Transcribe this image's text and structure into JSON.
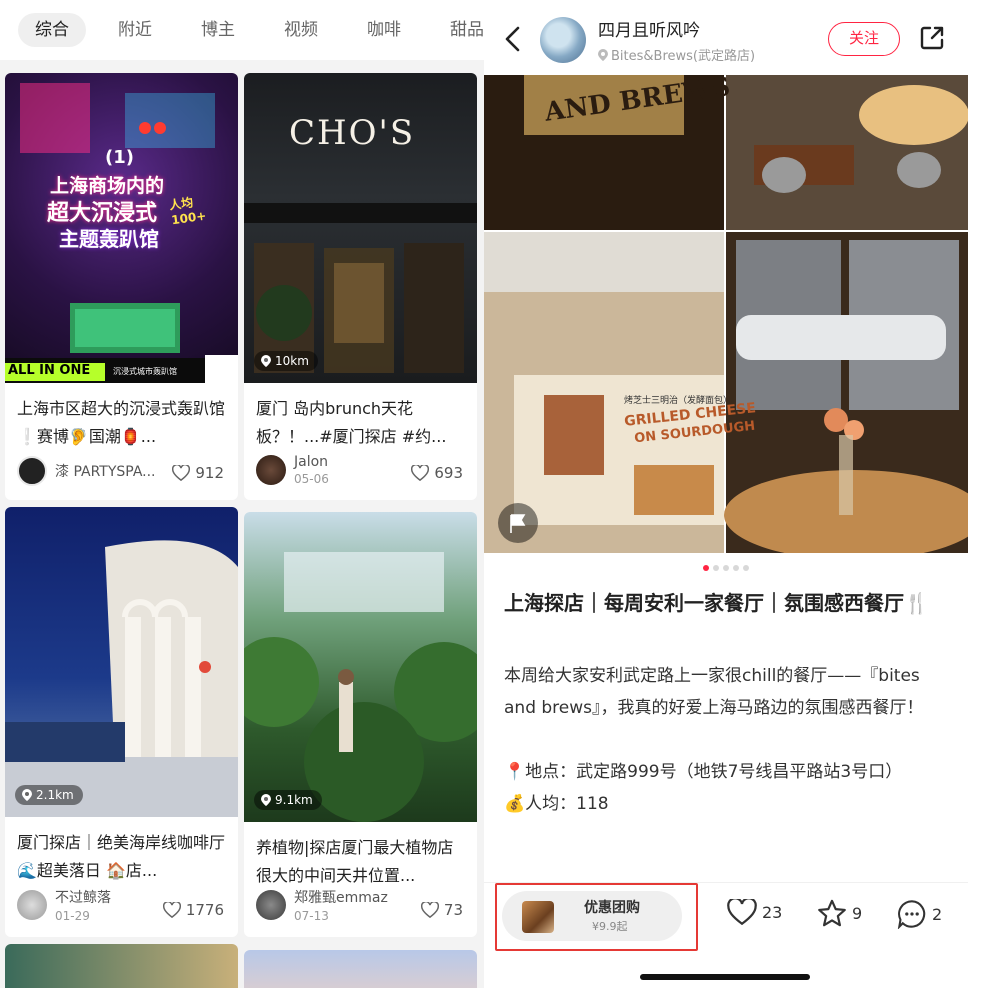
{
  "feed": {
    "tabs": [
      "综合",
      "附近",
      "博主",
      "视频",
      "咖啡",
      "甜品"
    ],
    "active_tab": "综合",
    "cards": [
      {
        "cover_text": {
          "top": "(1)",
          "l1": "上海商场内的",
          "l2": "超大沉浸式",
          "l3": "主题轰趴馆",
          "price": "人均100+",
          "footer": "ALL IN ONE",
          "footer_sub": "沉浸式城市轰趴馆"
        },
        "title": "上海市区超大的沉浸式轰趴馆❕赛博🦻国潮🏮...",
        "author": "漆 PARTYSPA...",
        "date": "",
        "likes": "912",
        "distance": ""
      },
      {
        "cover_text": {
          "sign": "CHO'S"
        },
        "title": "厦门 岛内brunch天花板？！...#厦门探店 #约...",
        "author": "Jalon",
        "date": "05-06",
        "likes": "693",
        "distance": "10km"
      },
      {
        "title": "厦门探店｜绝美海岸线咖啡厅🌊超美落日 🏠店...",
        "author": "不过鲸落",
        "date": "01-29",
        "likes": "1776",
        "distance": "2.1km"
      },
      {
        "title": "养植物|探店厦门最大植物店 很大的中间天井位置...",
        "author": "郑雅甄emmaz",
        "date": "07-13",
        "likes": "73",
        "distance": "9.1km"
      }
    ]
  },
  "post": {
    "author": "四月且听风吟",
    "location": "Bites&Brews(武定路店)",
    "follow_label": "关注",
    "photo_text": {
      "sign": "AND BREWS",
      "menu_l1": "GRILLED CHEESE",
      "menu_l2": "ON SOURDOUGH",
      "menu_cn": "烤芝士三明治（发酵面包）"
    },
    "page_count": 5,
    "current_page": 1,
    "title": "上海探店｜每周安利一家餐厅｜氛围感西餐厅🍴",
    "body_p1": "本周给大家安利武定路上一家很chill的餐厅——『bites and brews』，我真的好爱上海马路边的氛围感西餐厅！",
    "body_p2": "📍地点：武定路999号（地铁7号线昌平路站3号口）",
    "body_p3": "💰人均：118",
    "deal": {
      "title": "优惠团购",
      "price": "¥9.9起"
    },
    "likes": "23",
    "collects": "9",
    "comments": "2"
  },
  "colors": {
    "accent": "#ff2442",
    "highlight_box": "#e53935"
  }
}
